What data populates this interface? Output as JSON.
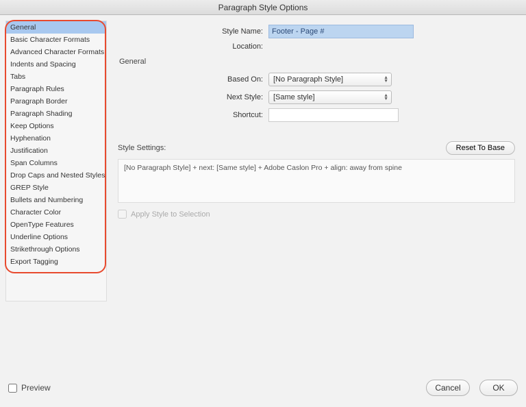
{
  "title": "Paragraph Style Options",
  "sidebar": {
    "items": [
      "General",
      "Basic Character Formats",
      "Advanced Character Formats",
      "Indents and Spacing",
      "Tabs",
      "Paragraph Rules",
      "Paragraph Border",
      "Paragraph Shading",
      "Keep Options",
      "Hyphenation",
      "Justification",
      "Span Columns",
      "Drop Caps and Nested Styles",
      "GREP Style",
      "Bullets and Numbering",
      "Character Color",
      "OpenType Features",
      "Underline Options",
      "Strikethrough Options",
      "Export Tagging"
    ],
    "selected_index": 0
  },
  "form": {
    "style_name_label": "Style Name:",
    "style_name_value": "Footer - Page #",
    "location_label": "Location:",
    "section_head": "General",
    "based_on_label": "Based On:",
    "based_on_value": "[No Paragraph Style]",
    "next_style_label": "Next Style:",
    "next_style_value": "[Same style]",
    "shortcut_label": "Shortcut:",
    "style_settings_label": "Style Settings:",
    "reset_label": "Reset To Base",
    "summary": "[No Paragraph Style] + next: [Same style] + Adobe Caslon Pro + align: away from spine",
    "apply_label": "Apply Style to Selection"
  },
  "footer": {
    "preview_label": "Preview",
    "cancel": "Cancel",
    "ok": "OK"
  }
}
